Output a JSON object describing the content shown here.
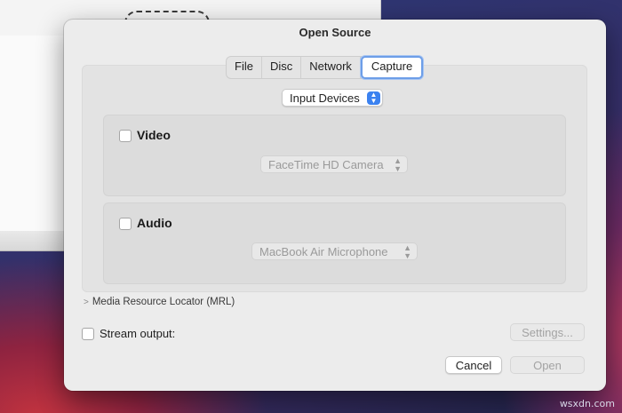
{
  "dialog": {
    "title": "Open Source"
  },
  "tabs": [
    {
      "label": "File",
      "selected": false
    },
    {
      "label": "Disc",
      "selected": false
    },
    {
      "label": "Network",
      "selected": false
    },
    {
      "label": "Capture",
      "selected": true
    }
  ],
  "capture": {
    "mode_select": {
      "value": "Input Devices",
      "icon": "stepper-arrows-icon"
    },
    "video": {
      "label": "Video",
      "checked": false,
      "device": "FaceTime HD Camera",
      "enabled": false
    },
    "audio": {
      "label": "Audio",
      "checked": false,
      "device": "MacBook Air Microphone",
      "enabled": false
    }
  },
  "mrl": {
    "label": "Media Resource Locator (MRL)",
    "icon": "chevron-right-icon"
  },
  "stream": {
    "label": "Stream output:",
    "checked": false,
    "settings_label": "Settings..."
  },
  "actions": {
    "cancel_label": "Cancel",
    "open_label": "Open"
  },
  "watermark": "wsxdn.com",
  "colors": {
    "accent": "#3b82f0",
    "tab_focus": "#6d9ee8"
  }
}
